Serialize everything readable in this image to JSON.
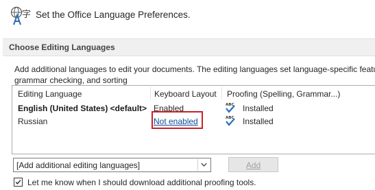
{
  "header": {
    "title": "Set the Office Language Preferences.",
    "icon": "language-translate-icon"
  },
  "section": {
    "title": "Choose Editing Languages"
  },
  "description": {
    "line1": "Add additional languages to edit your documents. The editing languages set language-specific featu",
    "line2": "grammar checking, and sorting"
  },
  "table": {
    "columns": [
      "Editing Language",
      "Keyboard Layout",
      "Proofing (Spelling, Grammar...)"
    ],
    "rows": [
      {
        "language": "English (United States) <default>",
        "keyboard": "Enabled",
        "proofing": "Installed",
        "proofing_icon": "abc-check-icon",
        "keyboard_is_link": false
      },
      {
        "language": "Russian",
        "keyboard": "Not enabled",
        "proofing": "Installed",
        "proofing_icon": "abc-check-icon",
        "keyboard_is_link": true
      }
    ]
  },
  "add_languages": {
    "dropdown_value": "[Add additional editing languages]",
    "button_label": "Add",
    "button_enabled": false
  },
  "checkbox": {
    "label": "Let me know when I should download additional proofing tools.",
    "checked": true
  },
  "colors": {
    "link": "#0b4c9a",
    "highlight": "#c4222b",
    "check_blue": "#2b6cb8"
  }
}
